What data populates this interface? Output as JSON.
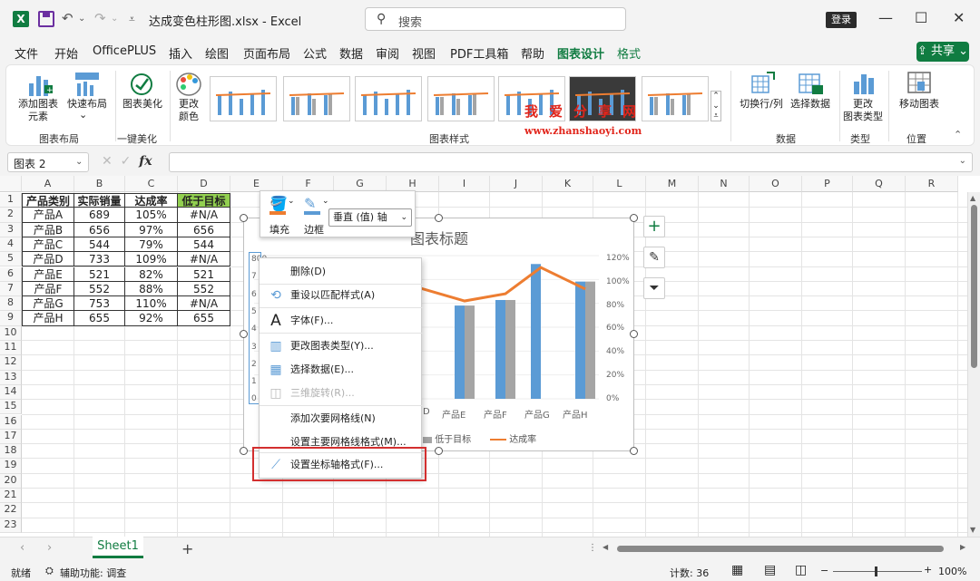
{
  "titlebar": {
    "filename": "达成变色柱形图.xlsx  -  Excel",
    "search_placeholder": "搜索",
    "login": "登录"
  },
  "menu": {
    "tabs": [
      "文件",
      "开始",
      "OfficePLUS",
      "插入",
      "绘图",
      "页面布局",
      "公式",
      "数据",
      "审阅",
      "视图",
      "PDF工具箱",
      "帮助",
      "图表设计",
      "格式"
    ],
    "active": "图表设计",
    "share": "共享"
  },
  "ribbon": {
    "add_element": "添加图表\n元素",
    "quick_layout": "快速布局",
    "beautify": "图表美化",
    "change_colors": "更改\n颜色",
    "switch_rowcol": "切换行/列",
    "select_data": "选择数据",
    "change_type": "更改\n图表类型",
    "move_chart": "移动图表",
    "groups": {
      "layout": "图表布局",
      "beautify": "一键美化",
      "styles": "图表样式",
      "data": "数据",
      "type": "类型",
      "location": "位置"
    }
  },
  "watermark": {
    "line1": "我爱分享网",
    "line2": "www.zhanshaoyi.com"
  },
  "formula_bar": {
    "name_box": "图表 2",
    "fx": "fx"
  },
  "grid": {
    "columns": [
      "A",
      "B",
      "C",
      "D",
      "E",
      "F",
      "G",
      "H",
      "I",
      "J",
      "K",
      "L",
      "M",
      "N",
      "O",
      "P",
      "Q",
      "R"
    ],
    "rows": [
      "1",
      "2",
      "3",
      "4",
      "5",
      "6",
      "7",
      "8",
      "9",
      "10",
      "11",
      "12",
      "13",
      "14",
      "15",
      "16",
      "17",
      "18",
      "19",
      "20",
      "21",
      "22",
      "23"
    ],
    "table_header": [
      "产品类别",
      "实际销量",
      "达成率",
      "低于目标"
    ],
    "table_rows": [
      [
        "产品A",
        "689",
        "105%",
        "#N/A"
      ],
      [
        "产品B",
        "656",
        "97%",
        "656"
      ],
      [
        "产品C",
        "544",
        "79%",
        "544"
      ],
      [
        "产品D",
        "733",
        "109%",
        "#N/A"
      ],
      [
        "产品E",
        "521",
        "82%",
        "521"
      ],
      [
        "产品F",
        "552",
        "88%",
        "552"
      ],
      [
        "产品G",
        "753",
        "110%",
        "#N/A"
      ],
      [
        "产品H",
        "655",
        "92%",
        "655"
      ]
    ],
    "header_highlight_color": "#92d050"
  },
  "chart": {
    "title": "图表标题",
    "left_axis_visible": [
      "800",
      "7",
      "6",
      "5",
      "4",
      "3",
      "2",
      "1",
      "0"
    ],
    "right_axis": [
      "120%",
      "100%",
      "80%",
      "60%",
      "40%",
      "20%",
      "0%"
    ],
    "x_visible": [
      "D",
      "产品E",
      "产品F",
      "产品G",
      "产品H"
    ],
    "legend": [
      "低于目标",
      "达成率"
    ]
  },
  "chart_data": {
    "type": "bar",
    "title": "图表标题",
    "categories": [
      "产品A",
      "产品B",
      "产品C",
      "产品D",
      "产品E",
      "产品F",
      "产品G",
      "产品H"
    ],
    "series": [
      {
        "name": "实际销量",
        "values": [
          689,
          656,
          544,
          733,
          521,
          552,
          753,
          655
        ],
        "color": "#5b9bd5"
      },
      {
        "name": "低于目标",
        "values": [
          null,
          656,
          544,
          null,
          521,
          552,
          null,
          655
        ],
        "color": "#a5a5a5"
      },
      {
        "name": "达成率",
        "type": "line",
        "values": [
          1.05,
          0.97,
          0.79,
          1.09,
          0.82,
          0.88,
          1.1,
          0.92
        ],
        "color": "#ed7d31"
      }
    ],
    "ylim": [
      0,
      800
    ],
    "y2lim": [
      0,
      1.2
    ]
  },
  "minitoolbar": {
    "fill": "填充",
    "border": "边框",
    "axis_select": "垂直 (值) 轴"
  },
  "context_menu": [
    {
      "label": "删除(D)",
      "icon": "none",
      "disabled": false
    },
    {
      "label": "重设以匹配样式(A)",
      "icon": "reset-icon",
      "disabled": false
    },
    {
      "label": "字体(F)...",
      "icon": "font-icon",
      "disabled": false
    },
    {
      "label": "更改图表类型(Y)...",
      "icon": "chart-type-icon",
      "disabled": false
    },
    {
      "label": "选择数据(E)...",
      "icon": "select-data-icon",
      "disabled": false
    },
    {
      "label": "三维旋转(R)...",
      "icon": "rotate-3d-icon",
      "disabled": true
    },
    {
      "label": "添加次要网格线(N)",
      "icon": "none",
      "disabled": false
    },
    {
      "label": "设置主要网格线格式(M)...",
      "icon": "none",
      "disabled": false
    },
    {
      "label": "设置坐标轴格式(F)...",
      "icon": "format-axis-icon",
      "disabled": false
    }
  ],
  "sheets": {
    "active": "Sheet1",
    "add": "+"
  },
  "statusbar": {
    "ready": "就绪",
    "accessibility": "辅助功能: 调查",
    "count": "计数: 36",
    "zoom": "100%"
  }
}
